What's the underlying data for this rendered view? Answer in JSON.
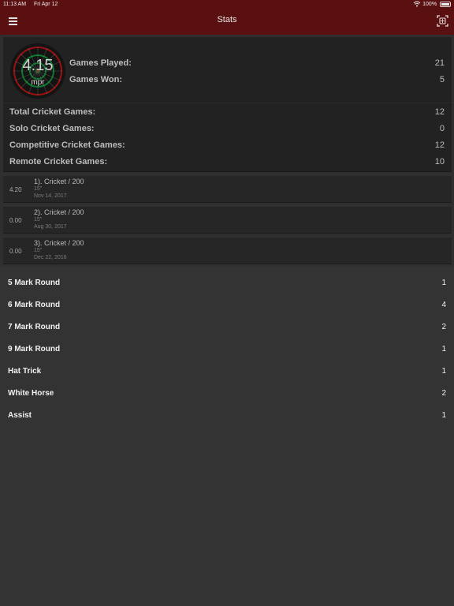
{
  "status": {
    "time": "11:13 AM",
    "date": "Fri Apr 12",
    "battery": "100%"
  },
  "nav": {
    "title": "Stats",
    "menu_icon": "hamburger-menu-icon",
    "scan_icon": "scan-icon"
  },
  "summary": {
    "mpr_value": "4.15",
    "mpr_label": "mpr",
    "games_played_label": "Games Played:",
    "games_played_value": "21",
    "games_won_label": "Games Won:",
    "games_won_value": "5",
    "total_cricket_label": "Total Cricket Games:",
    "total_cricket_value": "12",
    "solo_cricket_label": "Solo Cricket Games:",
    "solo_cricket_value": "0",
    "competitive_cricket_label": "Competitive Cricket Games:",
    "competitive_cricket_value": "12",
    "remote_cricket_label": "Remote Cricket Games:",
    "remote_cricket_value": "10"
  },
  "recent_games": [
    {
      "score": "4.20",
      "title": "1). Cricket / 200",
      "duration": "15\"",
      "date": "Nov 14, 2017"
    },
    {
      "score": "0.00",
      "title": "2). Cricket / 200",
      "duration": "15\"",
      "date": "Aug 30, 2017"
    },
    {
      "score": "0.00",
      "title": "3). Cricket / 200",
      "duration": "15\"",
      "date": "Dec 22, 2016"
    }
  ],
  "awards": [
    {
      "label": "5 Mark Round",
      "count": "1"
    },
    {
      "label": "6 Mark Round",
      "count": "4"
    },
    {
      "label": "7 Mark Round",
      "count": "2"
    },
    {
      "label": "9 Mark Round",
      "count": "1"
    },
    {
      "label": "Hat Trick",
      "count": "1"
    },
    {
      "label": "White Horse",
      "count": "2"
    },
    {
      "label": "Assist",
      "count": "1"
    }
  ],
  "colors": {
    "header": "#5a0f10",
    "panel": "#222222",
    "background": "#2f2f2f"
  }
}
